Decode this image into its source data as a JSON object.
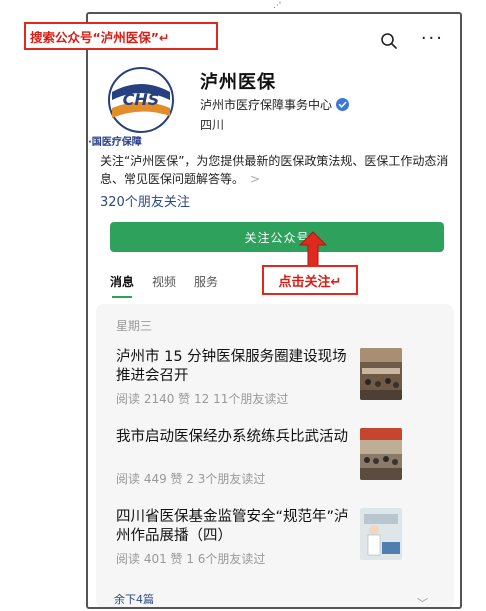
{
  "top_mark": ".·'",
  "account": {
    "name": "泸州医保",
    "org": "泸州市医疗保障事务中心",
    "region": "四川",
    "logo_text": "CHS",
    "logo_caption": "·国医疗保障",
    "description": "关注“泸州医保”，为您提供最新的医保政策法规、医保工作动态消息、常见医保问题解答等。",
    "followers": "320个朋友关注",
    "follow_label": "关注公众号"
  },
  "tabs": [
    {
      "label": "消息",
      "active": true
    },
    {
      "label": "视频",
      "active": false
    },
    {
      "label": "服务",
      "active": false
    }
  ],
  "feed": {
    "weekday": "星期三",
    "articles": [
      {
        "title": "泸州市 15 分钟医保服务圈建设现场推进会召开",
        "meta": "阅读 2140  赞 12  11个朋友读过"
      },
      {
        "title": "我市启动医保经办系统练兵比武活动",
        "meta": "阅读 449  赞 2  3个朋友读过"
      },
      {
        "title": "四川省医保基金监管安全“规范年”泸州作品展播（四）",
        "meta": "阅读 401  赞 1  6个朋友读过"
      }
    ],
    "remaining": "余下4篇"
  },
  "annotations": {
    "search_hint": "搜索公众号“泸州医保”↵",
    "follow_hint": "点击关注↵"
  },
  "colors": {
    "accent_green": "#2ea25d",
    "annotation_red": "#e02a20",
    "link_blue": "#2c4a80"
  }
}
